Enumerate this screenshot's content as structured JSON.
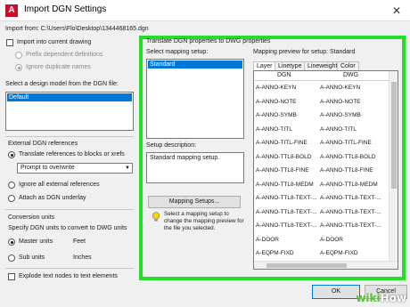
{
  "window": {
    "title": "Import DGN Settings",
    "app_icon_letter": "A",
    "close_glyph": "✕"
  },
  "import_from": "Import from:  C:\\Users\\Flo\\Desktop\\1344468165.dgn",
  "left": {
    "import_into_current": "Import into current drawing",
    "prefix_dependent": "Prefix dependent definitions",
    "ignore_duplicate": "Ignore duplicate names",
    "design_model_label": "Select a design model from the DGN file:",
    "design_models": [
      "Default"
    ],
    "external_refs_heading": "External DGN references",
    "translate_refs": "Translate references to blocks or xrefs",
    "prompt_combo": "Prompt to overwrite",
    "ignore_all_refs": "Ignore all external references",
    "attach_underlay": "Attach as DGN underlay",
    "conversion_heading": "Conversion units",
    "specify_units": "Specify DGN units to convert to DWG units",
    "master_units": "Master units",
    "master_value": "Feet",
    "sub_units": "Sub units",
    "sub_value": "Inches",
    "explode_text": "Explode text nodes to text elements"
  },
  "right": {
    "section_title": "Translate DGN properties to DWG properties",
    "select_mapping_label": "Select mapping setup:",
    "mapping_setups": [
      "Standard"
    ],
    "description_label": "Setup description:",
    "description_text": "Standard mapping setup.",
    "mapping_button": "Mapping Setups...",
    "hint_text": "Select a mapping setup to change the mapping preview for the file you selected.",
    "preview_label": "Mapping preview for setup: Standard",
    "tabs": [
      "Layer",
      "Linetype",
      "Lineweight",
      "Color"
    ],
    "columns": [
      "DGN",
      "DWG"
    ],
    "rows": [
      [
        "A-ANNO-KEYN",
        "A-ANNO-KEYN"
      ],
      [
        "A-ANNO-NOTE",
        "A-ANNO-NOTE"
      ],
      [
        "A-ANNO-SYMB",
        "A-ANNO-SYMB"
      ],
      [
        "A-ANNO-TITL",
        "A-ANNO-TITL"
      ],
      [
        "A-ANNO-TITL-FINE",
        "A-ANNO-TITL-FINE"
      ],
      [
        "A-ANNO-TTL8-BOLD",
        "A-ANNO-TTL8-BOLD"
      ],
      [
        "A-ANNO-TTL8-FINE",
        "A-ANNO-TTL8-FINE"
      ],
      [
        "A-ANNO-TTL8-MEDM",
        "A-ANNO-TTL8-MEDM"
      ],
      [
        "A-ANNO-TTL8-TEXT-...",
        "A-ANNO-TTL8-TEXT-..."
      ],
      [
        "A-ANNO-TTL8-TEXT-...",
        "A-ANNO-TTL8-TEXT-..."
      ],
      [
        "A-ANNO-TTL8-TEXT-...",
        "A-ANNO-TTL8-TEXT-..."
      ],
      [
        "A-DOOR",
        "A-DOOR"
      ],
      [
        "A-EQPM-FIXD",
        "A-EQPM-FIXD"
      ]
    ]
  },
  "footer": {
    "ok": "OK",
    "cancel": "Cancel"
  },
  "watermark": {
    "brand": "wiki",
    "rest": "How"
  },
  "colors": {
    "highlight": "#24e024",
    "selection": "#0078d7",
    "app_icon": "#c8102e"
  }
}
